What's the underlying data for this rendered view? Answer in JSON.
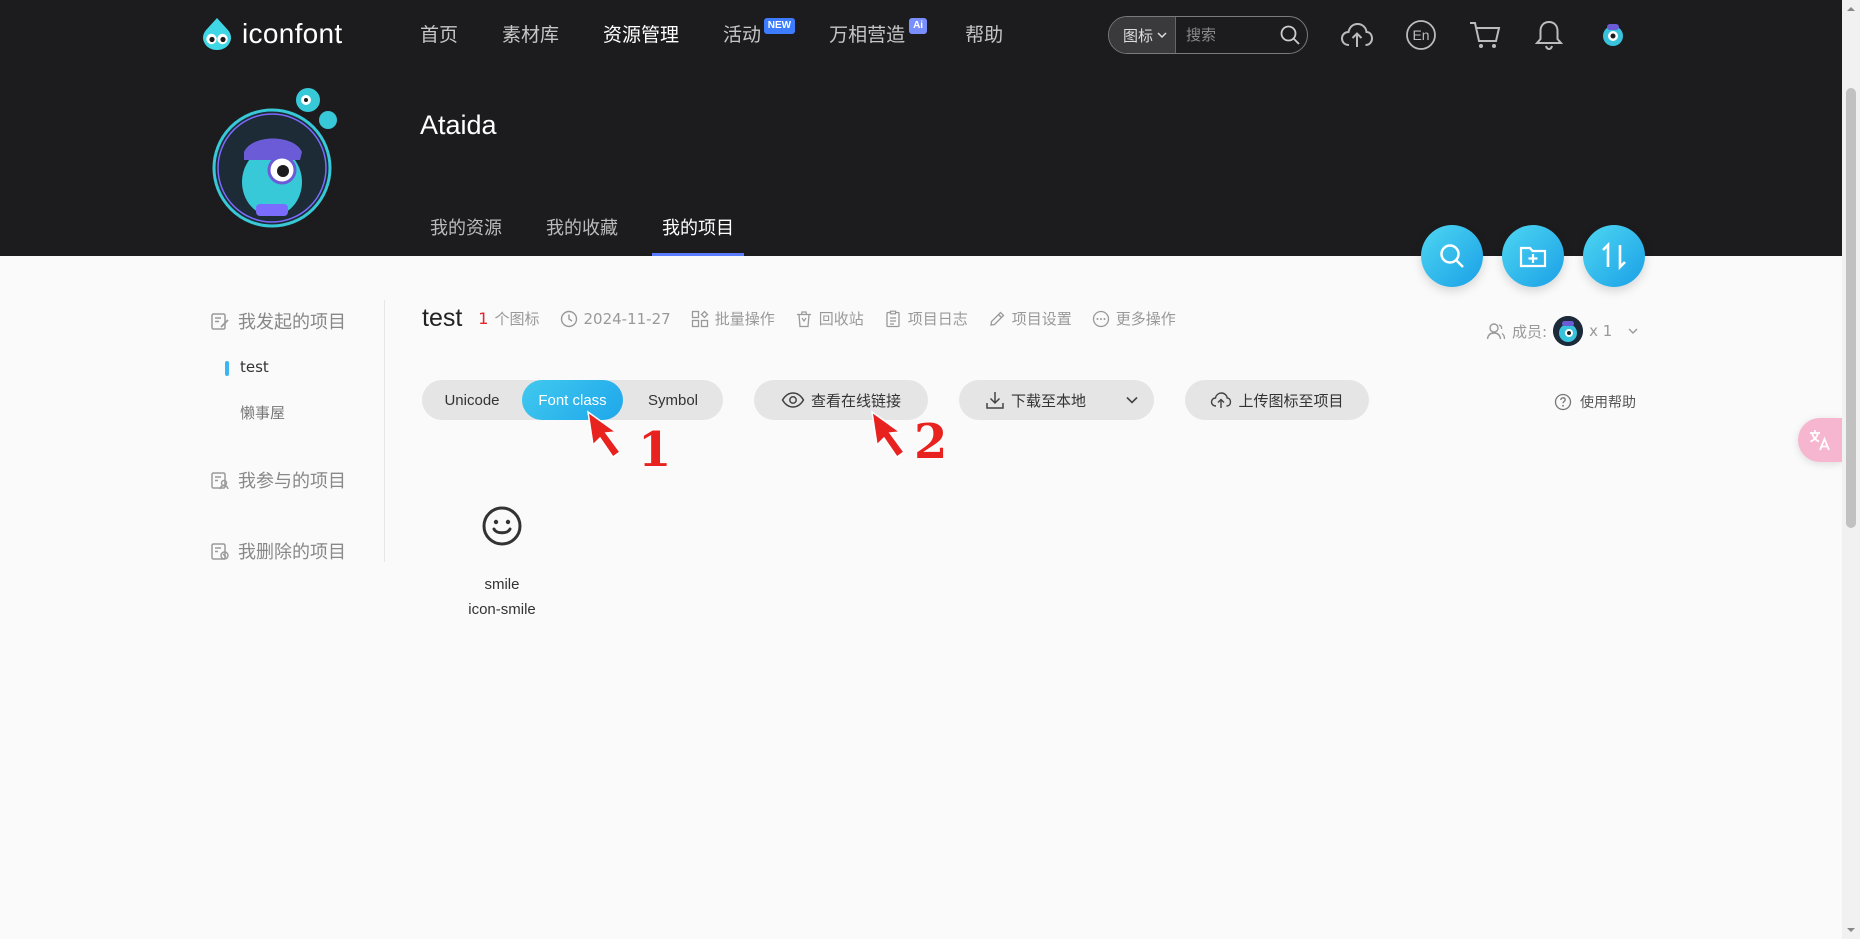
{
  "brand": {
    "name": "iconfont"
  },
  "nav": {
    "items": [
      {
        "label": "首页",
        "active": false
      },
      {
        "label": "素材库",
        "active": false
      },
      {
        "label": "资源管理",
        "active": true
      },
      {
        "label": "活动",
        "badge": "NEW"
      },
      {
        "label": "万相营造",
        "badge": "Ai"
      },
      {
        "label": "帮助",
        "active": false
      }
    ]
  },
  "search": {
    "type": "图标",
    "placeholder": "搜索"
  },
  "top_icons": [
    "upload-cloud-icon",
    "language-en-icon",
    "cart-icon",
    "bell-icon",
    "user-avatar"
  ],
  "profile": {
    "username": "Ataida"
  },
  "subtabs": [
    {
      "label": "我的资源",
      "active": false
    },
    {
      "label": "我的收藏",
      "active": false
    },
    {
      "label": "我的项目",
      "active": true
    }
  ],
  "sidebar": {
    "created_group": "我发起的项目",
    "created_items": [
      {
        "label": "test",
        "active": true
      },
      {
        "label": "懒事屋",
        "active": false
      }
    ],
    "joined_group": "我参与的项目",
    "deleted_group": "我删除的项目"
  },
  "project": {
    "title": "test",
    "icon_count": "1",
    "icon_count_label": "个图标",
    "date": "2024-11-27",
    "actions": [
      "批量操作",
      "回收站",
      "项目日志",
      "项目设置",
      "更多操作"
    ],
    "members_label": "成员:",
    "members_count": "x 1"
  },
  "format_tabs": [
    {
      "label": "Unicode",
      "active": false
    },
    {
      "label": "Font class",
      "active": true
    },
    {
      "label": "Symbol",
      "active": false
    }
  ],
  "buttons": {
    "view_online_link": "查看在线链接",
    "download_local": "下载至本地",
    "upload_to_project": "上传图标至项目",
    "help": "使用帮助"
  },
  "icons": [
    {
      "name": "smile",
      "class": "icon-smile"
    }
  ],
  "annotations": [
    "1",
    "2"
  ],
  "colors": {
    "header_bg": "#1c1c1e",
    "accent": "#1ea7ea",
    "count_red": "#e3262a",
    "arrow_red": "#e8231f",
    "tab_underline": "#5b7bff"
  }
}
